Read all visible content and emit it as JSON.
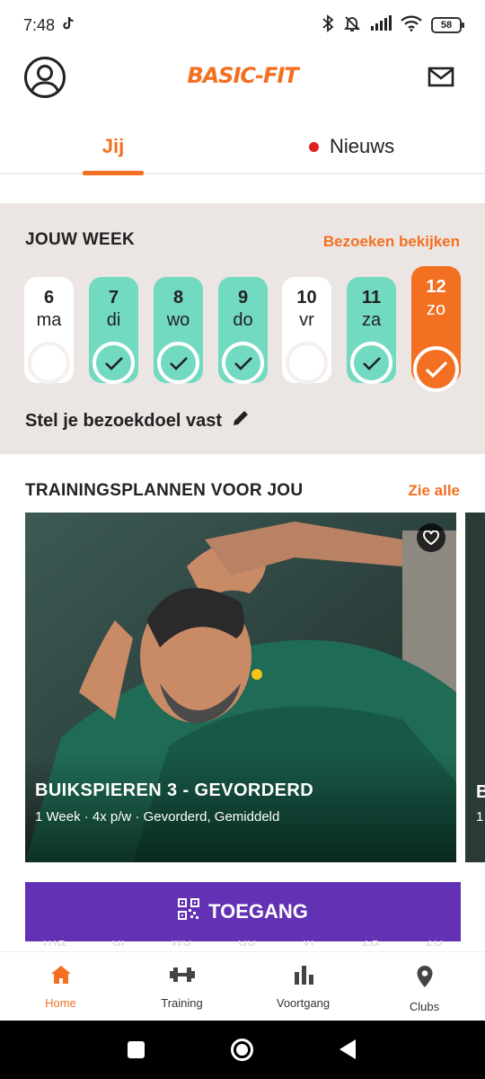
{
  "status_bar": {
    "time": "7:48",
    "battery": "58"
  },
  "header": {
    "logo": "BASIC-FIT"
  },
  "tabs": {
    "jij": "Jij",
    "nieuws": "Nieuws"
  },
  "week": {
    "title": "JOUW WEEK",
    "link": "Bezoeken bekijken",
    "days": [
      {
        "num": "6",
        "name": "ma",
        "state": "empty"
      },
      {
        "num": "7",
        "name": "di",
        "state": "done"
      },
      {
        "num": "8",
        "name": "wo",
        "state": "done"
      },
      {
        "num": "9",
        "name": "do",
        "state": "done"
      },
      {
        "num": "10",
        "name": "vr",
        "state": "empty"
      },
      {
        "num": "11",
        "name": "za",
        "state": "done"
      },
      {
        "num": "12",
        "name": "zo",
        "state": "today-done"
      }
    ],
    "goal": "Stel je bezoekdoel vast"
  },
  "plans": {
    "title": "TRAININGSPLANNEN VOOR JOU",
    "link": "Zie alle",
    "card": {
      "title": "BUIKSPIEREN 3 - GEVORDERD",
      "subtitle": "1 Week · 4x p/w · Gevorderd, Gemiddeld"
    },
    "next_card": {
      "title_peek": "B",
      "subtitle_peek": "1"
    }
  },
  "access_button": {
    "label": "TOEGANG"
  },
  "ghost_days": [
    "ma",
    "di",
    "wo",
    "do",
    "vr",
    "za",
    "zo"
  ],
  "bottom_nav": {
    "home": "Home",
    "training": "Training",
    "voortgang": "Voortgang",
    "clubs": "Clubs"
  },
  "colors": {
    "accent": "#f36f21",
    "teal": "#72dac0",
    "purple": "#6331b4"
  }
}
